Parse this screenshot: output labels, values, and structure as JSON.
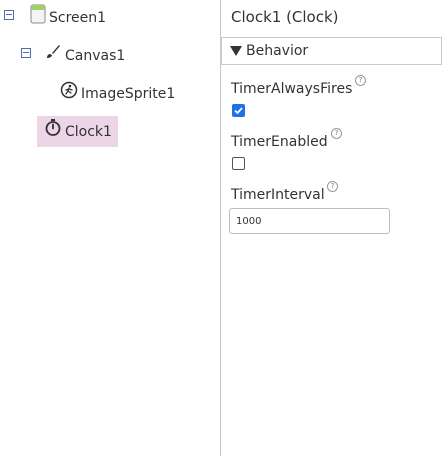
{
  "tree": {
    "screen": {
      "label": "Screen1",
      "icon": "screen-icon"
    },
    "canvas": {
      "label": "Canvas1",
      "icon": "paintbrush-icon"
    },
    "imagesprite": {
      "label": "ImageSprite1",
      "icon": "running-figure-icon"
    },
    "clock": {
      "label": "Clock1",
      "icon": "stopwatch-icon",
      "selected": true
    }
  },
  "properties": {
    "title": "Clock1 (Clock)",
    "section": "Behavior",
    "timer_always_fires": {
      "label": "TimerAlwaysFires",
      "checked": true,
      "help": "?"
    },
    "timer_enabled": {
      "label": "TimerEnabled",
      "checked": false,
      "help": "?"
    },
    "timer_interval": {
      "label": "TimerInterval",
      "value": "1000",
      "help": "?"
    }
  },
  "colors": {
    "selection": "#ecd5e6",
    "checkbox_checked": "#1a73e8",
    "toggle": "#4a6fb5"
  }
}
